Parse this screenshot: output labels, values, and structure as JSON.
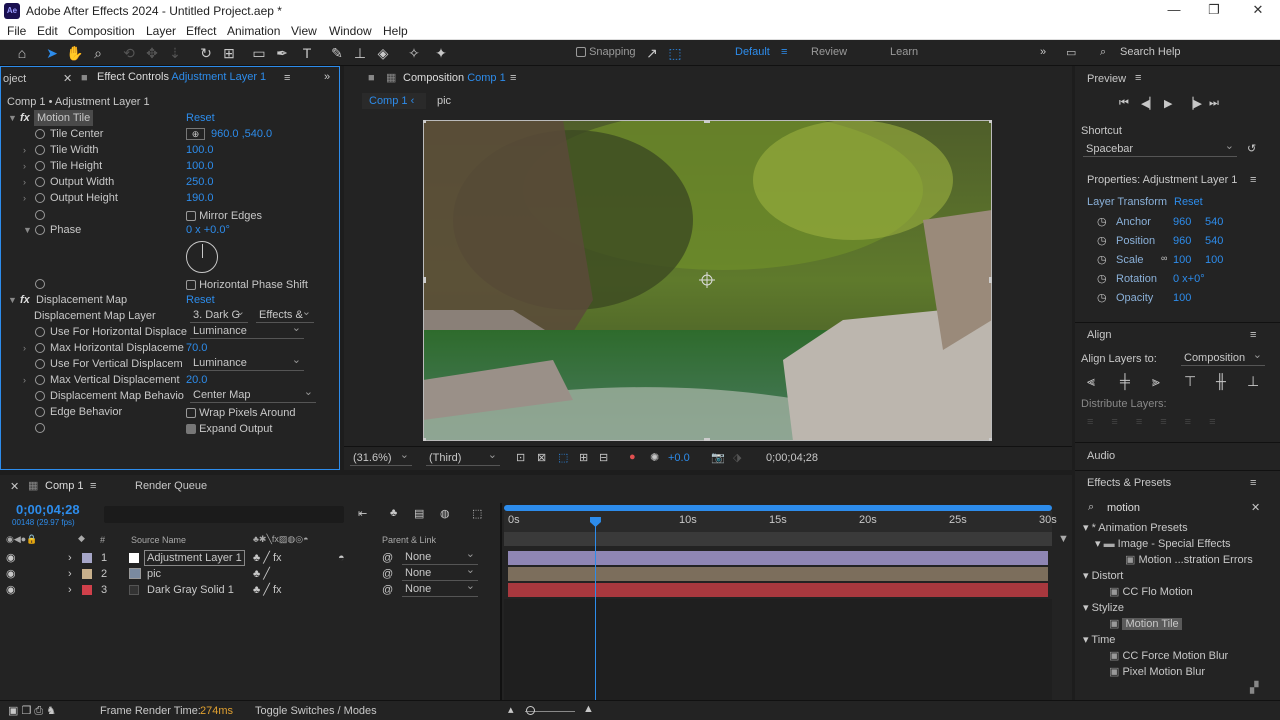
{
  "window": {
    "title": "Adobe After Effects 2024 - Untitled Project.aep *",
    "logo": "Ae"
  },
  "menu": [
    "File",
    "Edit",
    "Composition",
    "Layer",
    "Effect",
    "Animation",
    "View",
    "Window",
    "Help"
  ],
  "toolbar": {
    "snapping": "Snapping",
    "workspaces": [
      "Default",
      "Review",
      "Learn"
    ],
    "search": "Search Help"
  },
  "project_tab": "oject",
  "effect_controls": {
    "tab_label": "Effect Controls",
    "tab_target": "Adjustment Layer 1",
    "breadcrumb": "Comp 1 • Adjustment Layer 1",
    "motion_tile": {
      "name": "Motion Tile",
      "reset": "Reset",
      "tile_center_label": "Tile Center",
      "tile_center": "960.0 ,540.0",
      "tile_width_label": "Tile Width",
      "tile_width": "100.0",
      "tile_height_label": "Tile Height",
      "tile_height": "100.0",
      "output_width_label": "Output Width",
      "output_width": "250.0",
      "output_height_label": "Output Height",
      "output_height": "190.0",
      "mirror_edges": "Mirror Edges",
      "phase_label": "Phase",
      "phase": "0 x +0.0°",
      "hps": "Horizontal Phase Shift"
    },
    "displacement": {
      "name": "Displacement Map",
      "reset": "Reset",
      "map_layer_label": "Displacement Map Layer",
      "map_layer": "3. Dark G",
      "map_layer_src": "Effects &",
      "h_use_label": "Use For Horizontal Displace",
      "h_use": "Luminance",
      "h_max_label": "Max Horizontal Displaceme",
      "h_max": "70.0",
      "v_use_label": "Use For Vertical Displacem",
      "v_use": "Luminance",
      "v_max_label": "Max Vertical Displacement",
      "v_max": "20.0",
      "behavior_label": "Displacement Map Behavio",
      "behavior": "Center Map",
      "edge_label": "Edge Behavior",
      "wrap": "Wrap Pixels Around",
      "expand": "Expand Output"
    }
  },
  "composition": {
    "tab_label": "Composition",
    "tab_target": "Comp 1",
    "crumbs": [
      "Comp 1",
      "pic"
    ],
    "zoom": "(31.6%)",
    "resolution": "(Third)",
    "exposure": "+0.0",
    "timecode": "0;00;04;28"
  },
  "preview": {
    "title": "Preview",
    "shortcut_label": "Shortcut",
    "shortcut": "Spacebar"
  },
  "properties": {
    "title": "Properties: Adjustment Layer 1",
    "group": "Layer Transform",
    "reset": "Reset",
    "rows": [
      {
        "label": "Anchor",
        "v1": "960",
        "v2": "540"
      },
      {
        "label": "Position",
        "v1": "960",
        "v2": "540"
      },
      {
        "label": "Scale",
        "v1": "100",
        "v2": "100"
      },
      {
        "label": "Rotation",
        "v1": "0 x+0°",
        "v2": ""
      },
      {
        "label": "Opacity",
        "v1": "100",
        "v2": ""
      }
    ]
  },
  "align": {
    "title": "Align",
    "align_to_label": "Align Layers to:",
    "align_to": "Composition",
    "distribute": "Distribute Layers:"
  },
  "audio": "Audio",
  "effects_presets": {
    "title": "Effects & Presets",
    "search": "motion",
    "tree": [
      {
        "text": "* Animation Presets",
        "level": 0
      },
      {
        "text": "Image - Special Effects",
        "level": 1
      },
      {
        "text": "Motion ...stration Errors",
        "level": 2
      },
      {
        "text": "Distort",
        "level": 0
      },
      {
        "text": "CC Flo Motion",
        "level": 2
      },
      {
        "text": "Stylize",
        "level": 0
      },
      {
        "text": "Motion Tile",
        "level": 2,
        "selected": true
      },
      {
        "text": "Time",
        "level": 0
      },
      {
        "text": "CC Force Motion Blur",
        "level": 2
      },
      {
        "text": "Pixel Motion Blur",
        "level": 2
      }
    ]
  },
  "timeline": {
    "tab": "Comp 1",
    "render_queue": "Render Queue",
    "timecode": "0;00;04;28",
    "frames": "00148 (29.97 fps)",
    "col_source": "Source Name",
    "col_parent": "Parent & Link",
    "ruler": [
      "0s",
      "10s",
      "15s",
      "20s",
      "25s",
      "30s"
    ],
    "playhead": 0.166,
    "layers": [
      {
        "num": "1",
        "name": "Adjustment Layer 1",
        "parent": "None",
        "color": "#a6a6c8",
        "bar": "#8f86b4"
      },
      {
        "num": "2",
        "name": "pic",
        "parent": "None",
        "color": "#c8b08c",
        "bar": "#7c6e5c"
      },
      {
        "num": "3",
        "name": "Dark Gray Solid 1",
        "parent": "None",
        "color": "#d0404a",
        "bar": "#a8383e"
      }
    ]
  },
  "status": {
    "render_label": "Frame Render Time:",
    "render_time": "274ms",
    "toggle": "Toggle Switches / Modes"
  }
}
